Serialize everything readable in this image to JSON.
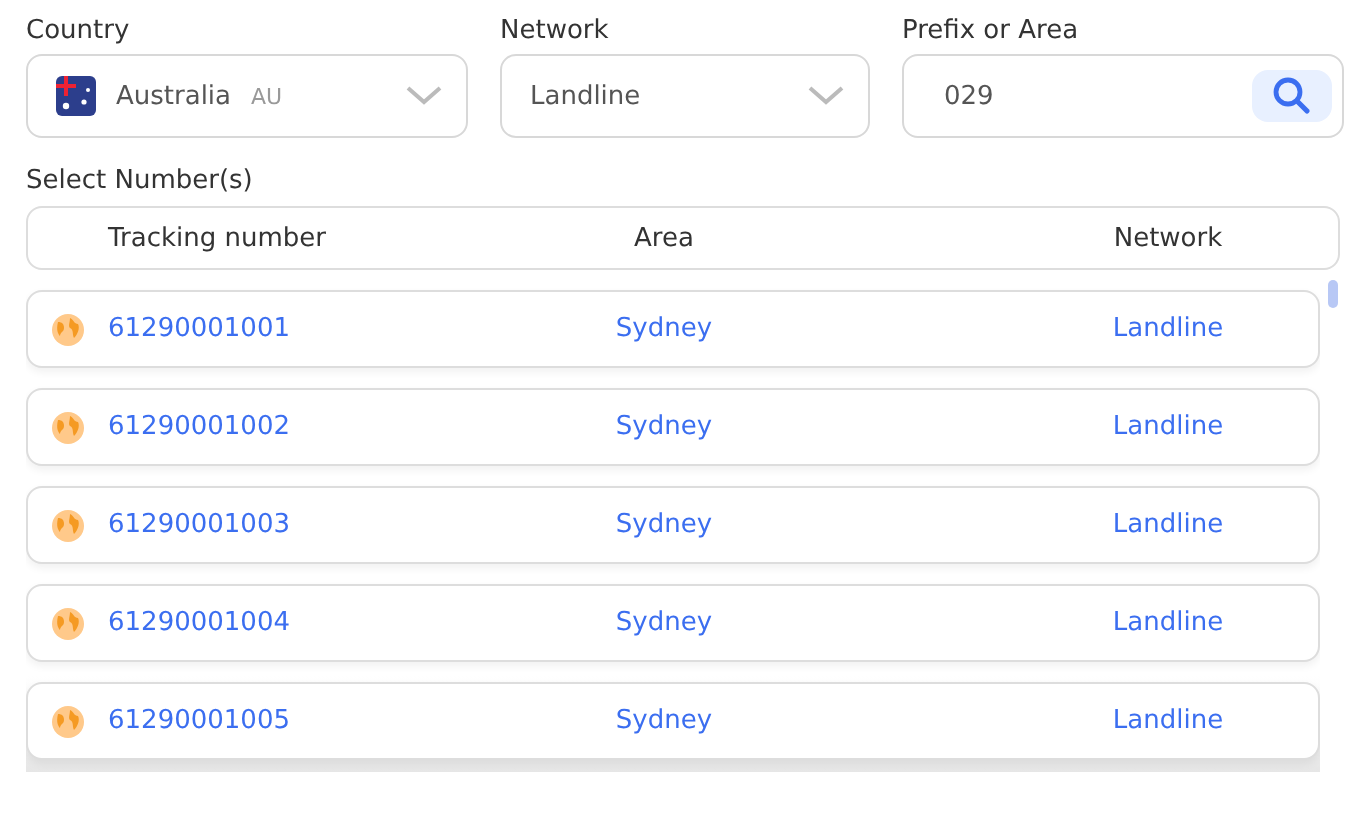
{
  "filters": {
    "country": {
      "label": "Country",
      "value": "Australia",
      "code": "AU"
    },
    "network": {
      "label": "Network",
      "value": "Landline"
    },
    "prefix": {
      "label": "Prefix or Area",
      "value": "029"
    }
  },
  "list_title": "Select Number(s)",
  "table": {
    "columns": [
      "Tracking number",
      "Area",
      "Network"
    ],
    "rows": [
      {
        "number": "61290001001",
        "area": "Sydney",
        "network": "Landline"
      },
      {
        "number": "61290001002",
        "area": "Sydney",
        "network": "Landline"
      },
      {
        "number": "61290001003",
        "area": "Sydney",
        "network": "Landline"
      },
      {
        "number": "61290001004",
        "area": "Sydney",
        "network": "Landline"
      },
      {
        "number": "61290001005",
        "area": "Sydney",
        "network": "Landline"
      }
    ]
  }
}
